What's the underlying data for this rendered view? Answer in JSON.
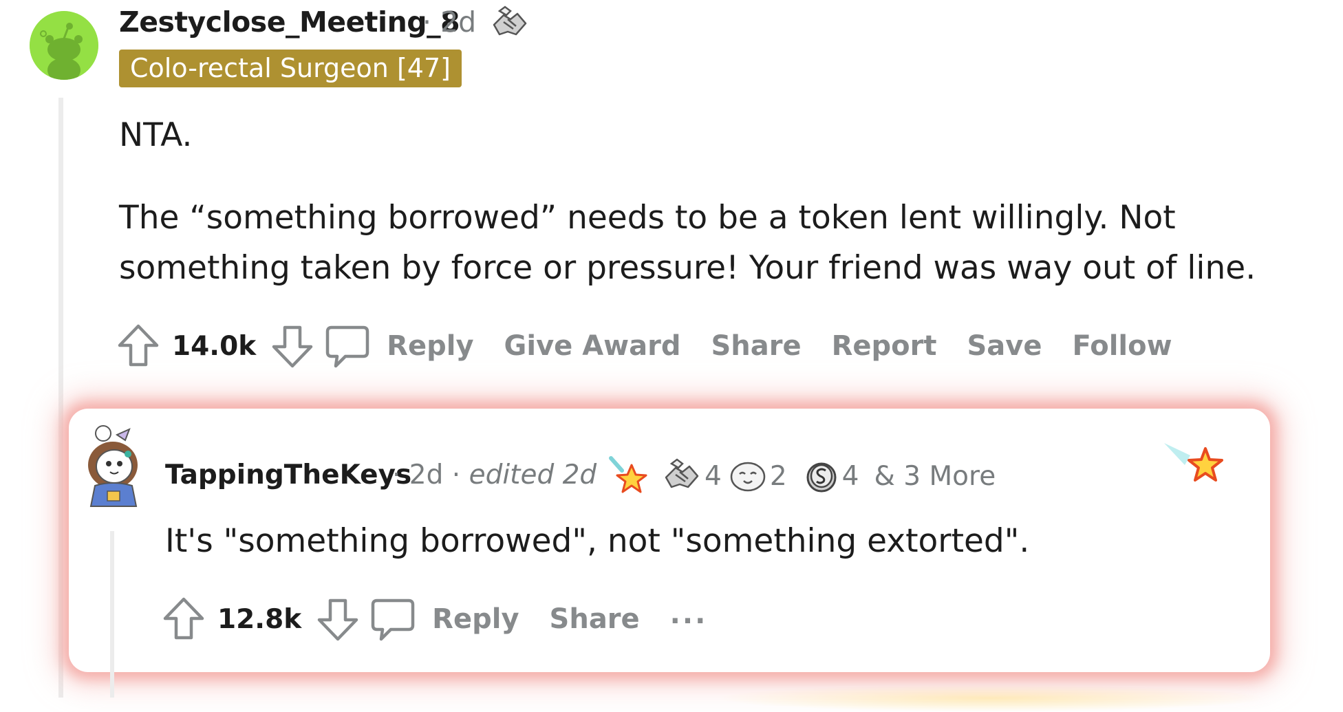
{
  "comment": {
    "author": "Zestyclose_Meeting_8",
    "age": "2d",
    "flair": "Colo-rectal Surgeon [47]",
    "paragraphs": [
      "NTA.",
      "The “something borrowed” needs to be a token lent willingly. Not something taken by force or pressure! Your friend was way out of line."
    ],
    "score": "14.0k",
    "actions": {
      "reply": "Reply",
      "give_award": "Give Award",
      "share": "Share",
      "report": "Report",
      "save": "Save",
      "follow": "Follow"
    }
  },
  "reply": {
    "author": "TappingTheKeys",
    "age": "2d",
    "edited": "edited 2d",
    "awards": [
      {
        "icon": "helpful-handshake-award-icon",
        "count": "4"
      },
      {
        "icon": "wholesome-face-award-icon",
        "count": "2"
      },
      {
        "icon": "silver-coin-award-icon",
        "count": "4"
      }
    ],
    "more_awards": "& 3 More",
    "text": "It's \"something borrowed\", not \"something extorted\".",
    "score": "12.8k",
    "actions": {
      "reply": "Reply",
      "share": "Share",
      "more": "..."
    }
  },
  "colors": {
    "flair_bg": "#ae9131",
    "avatar_green": "#94e044",
    "muted_text": "#878a8c",
    "highlight_glow": "#f3a09b"
  }
}
